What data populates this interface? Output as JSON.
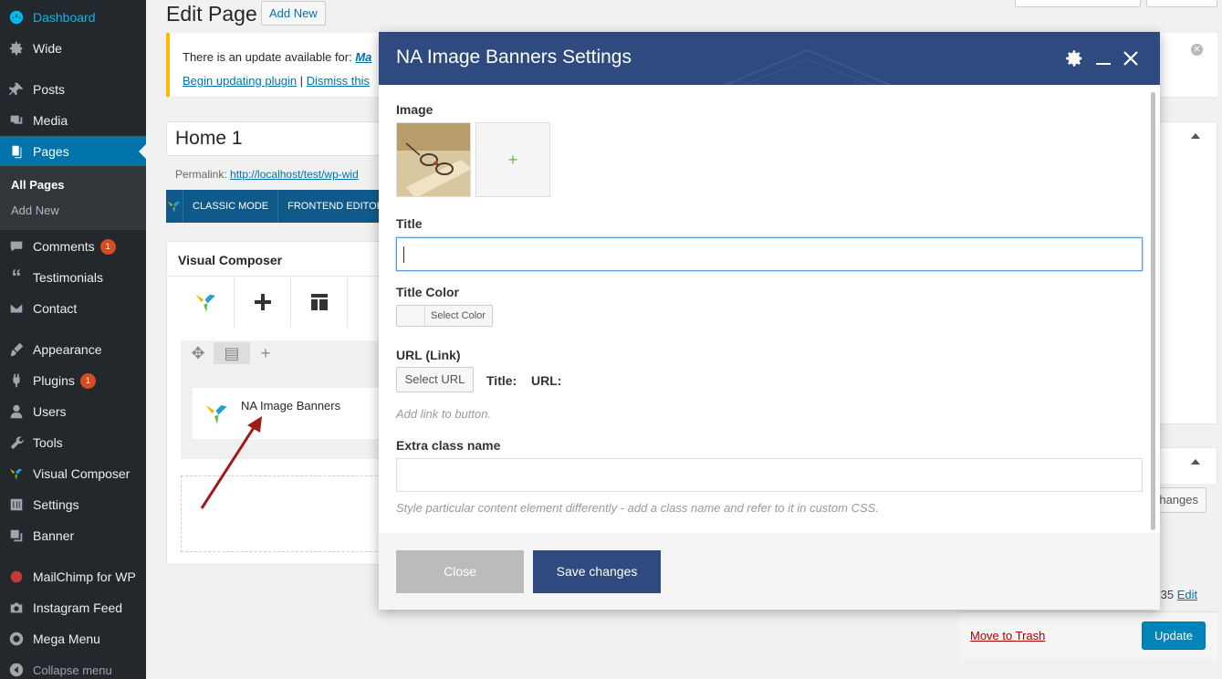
{
  "sidebar": {
    "dashboard": "Dashboard",
    "wide": "Wide",
    "posts": "Posts",
    "media": "Media",
    "pages": "Pages",
    "submenu": {
      "all_pages": "All Pages",
      "add_new": "Add New"
    },
    "comments": "Comments",
    "comments_count": "1",
    "testimonials": "Testimonials",
    "contact": "Contact",
    "appearance": "Appearance",
    "plugins": "Plugins",
    "plugins_count": "1",
    "users": "Users",
    "tools": "Tools",
    "visual_composer": "Visual Composer",
    "settings": "Settings",
    "banner": "Banner",
    "mailchimp": "MailChimp for WP",
    "instagram": "Instagram Feed",
    "mega_menu": "Mega Menu",
    "collapse": "Collapse menu"
  },
  "header": {
    "title": "Edit Page",
    "add_new": "Add New"
  },
  "notice": {
    "text": "There is an update available for: ",
    "plugin_link": "Ma",
    "begin_link": "Begin updating plugin",
    "separator": " | ",
    "dismiss_link": "Dismiss this"
  },
  "post": {
    "title_value": "Home 1",
    "permalink_label": "Permalink: ",
    "permalink_url": "http://localhost/test/wp-wid"
  },
  "vc_bar": {
    "classic": "CLASSIC MODE",
    "frontend": "FRONTEND EDITOR"
  },
  "vc_panel": {
    "title": "Visual Composer",
    "element_label": "NA Image Banners"
  },
  "right": {
    "changes_btn": "hanges",
    "time_text": ":35 ",
    "edit_link": "Edit",
    "trash_link": "Move to Trash",
    "update_btn": "Update"
  },
  "modal": {
    "title": "NA Image Banners Settings",
    "image_label": "Image",
    "add_image": "+",
    "title_label": "Title",
    "title_value": "",
    "title_color_label": "Title Color",
    "select_color": "Select Color",
    "url_label": "URL (Link)",
    "select_url": "Select URL",
    "url_title_label": "Title:",
    "url_label_short": "URL:",
    "url_help": "Add link to button.",
    "extra_class_label": "Extra class name",
    "extra_class_value": "",
    "extra_class_help": "Style particular content element differently - add a class name and refer to it in custom CSS.",
    "close_btn": "Close",
    "save_btn": "Save changes"
  },
  "colors": {
    "sidebar_bg": "#23282d",
    "active_blue": "#0073aa",
    "modal_header": "#2e4a7f",
    "notice_border": "#ffb900",
    "badge": "#d54e21",
    "arrow": "#a01a1a"
  }
}
